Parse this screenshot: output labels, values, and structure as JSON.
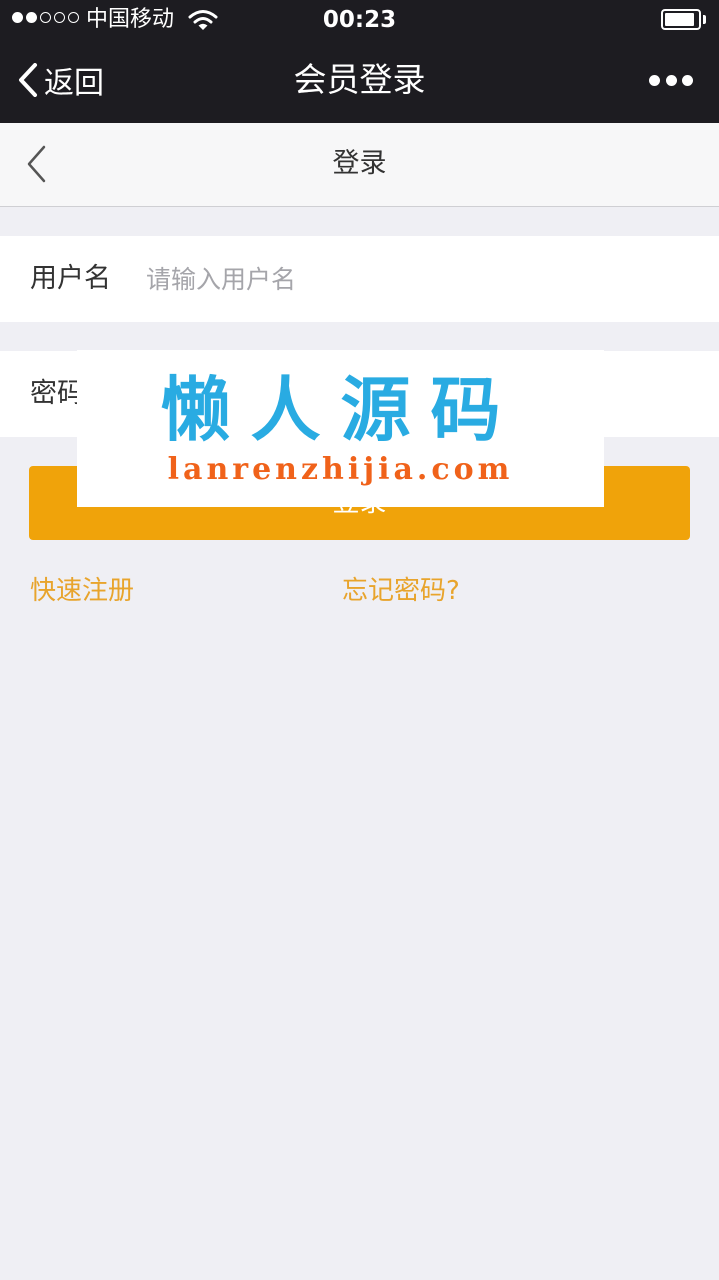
{
  "status_bar": {
    "carrier": "中国移动",
    "time": "00:23",
    "signal_bars_filled": 2,
    "signal_bars_total": 5,
    "battery_level": 0.9
  },
  "nav_bar": {
    "back_label": "返回",
    "title": "会员登录",
    "more_icon": "more-dots-icon"
  },
  "sub_header": {
    "title": "登录",
    "back_icon": "chevron-left-icon"
  },
  "form": {
    "username_label": "用户名",
    "username_placeholder": "请输入用户名",
    "password_label": "密码",
    "password_placeholder": "",
    "login_button": "登录"
  },
  "links": {
    "register": "快速注册",
    "forgot_password": "忘记密码?"
  },
  "watermark": {
    "title": "懒人源码",
    "url": "lanrenzhijia.com"
  },
  "colors": {
    "nav_background": "#1d1c21",
    "page_background": "#efeff4",
    "accent": "#f0a30a",
    "link": "#e8a42c",
    "watermark_title": "#29abe2",
    "watermark_url": "#f0621a"
  }
}
